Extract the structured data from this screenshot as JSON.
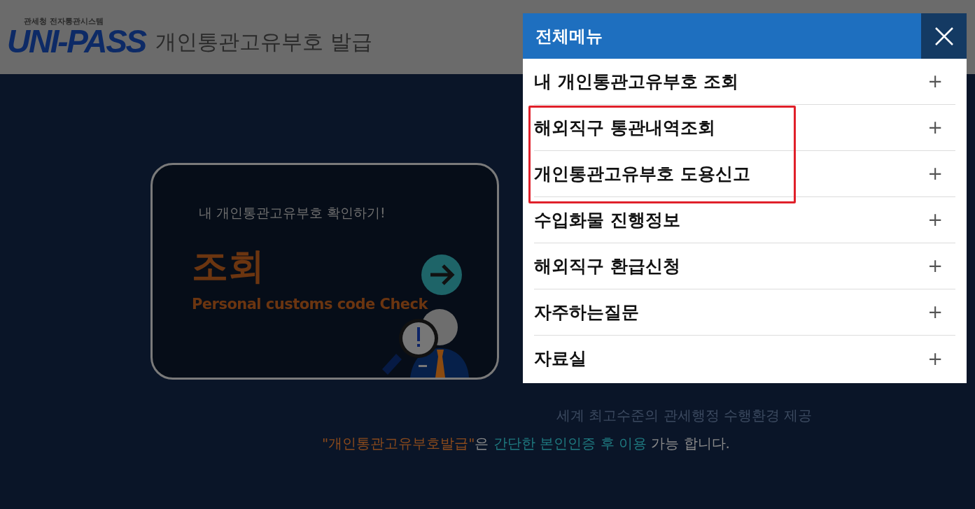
{
  "header": {
    "agency": "관세청 전자통관시스템",
    "logo": "UNI-PASS",
    "title": "개인통관고유부호 발급"
  },
  "card": {
    "prompt": "내 개인통관고유부호 확인하기!",
    "title": "조회",
    "subtitle": "Personal customs code Check"
  },
  "tagline": "세계 최고수준의 관세행정 수행환경 제공",
  "notice": [
    {
      "kind": "accent",
      "text": "\"개인통관고유부호발급\""
    },
    {
      "kind": "plain",
      "text": "은 "
    },
    {
      "kind": "link",
      "text": "간단한 본인인증 후 이용"
    },
    {
      "kind": "plain",
      "text": " 가능 합니다."
    }
  ],
  "menu": {
    "title": "전체메뉴",
    "items": [
      {
        "label": "내 개인통관고유부호 조회",
        "expand_icon": "+",
        "highlighted": false
      },
      {
        "label": "해외직구 통관내역조회",
        "expand_icon": "+",
        "highlighted": true
      },
      {
        "label": "개인통관고유부호 도용신고",
        "expand_icon": "+",
        "highlighted": true
      },
      {
        "label": "수입화물 진행정보",
        "expand_icon": "+",
        "highlighted": false
      },
      {
        "label": "해외직구 환급신청",
        "expand_icon": "+",
        "highlighted": false
      },
      {
        "label": "자주하는질문",
        "expand_icon": "+",
        "highlighted": false
      },
      {
        "label": "자료실",
        "expand_icon": "+",
        "highlighted": false
      }
    ]
  }
}
